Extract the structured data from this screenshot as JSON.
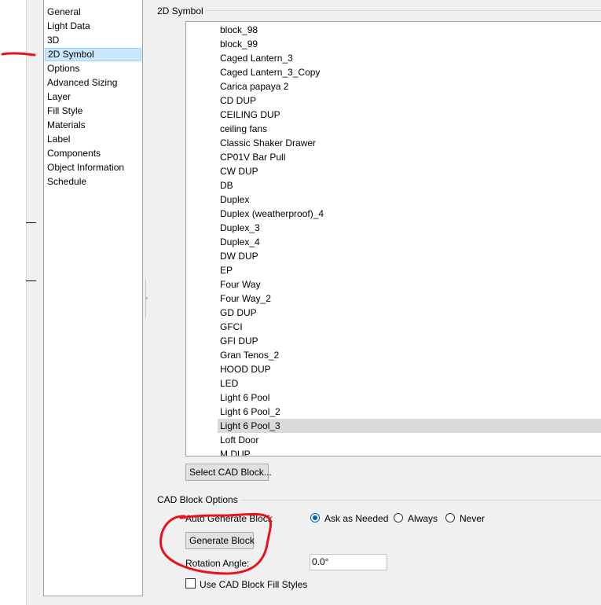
{
  "nav": {
    "items": [
      "General",
      "Light Data",
      "3D",
      "2D Symbol",
      "Options",
      "Advanced Sizing",
      "Layer",
      "Fill Style",
      "Materials",
      "Label",
      "Components",
      "Object Information",
      "Schedule"
    ],
    "selected": "2D Symbol"
  },
  "symbol_group": {
    "title": "2D Symbol",
    "items": [
      "block_98",
      "block_99",
      "Caged Lantern_3",
      "Caged Lantern_3_Copy",
      "Carica papaya 2",
      "CD DUP",
      "CEILING DUP",
      "ceiling fans",
      "Classic Shaker Drawer",
      "CP01V Bar Pull",
      "CW DUP",
      "DB",
      "Duplex",
      "Duplex (weatherproof)_4",
      "Duplex_3",
      "Duplex_4",
      "DW DUP",
      "EP",
      "Four Way",
      "Four Way_2",
      "GD DUP",
      "GFCI",
      "GFI DUP",
      "Gran Tenos_2",
      "HOOD DUP",
      "LED",
      "Light 6 Pool",
      "Light 6 Pool_2",
      "Light 6 Pool_3",
      "Loft Door",
      "M DUP"
    ],
    "selected": "Light 6 Pool_3",
    "select_button": "Select CAD Block..."
  },
  "cad_options": {
    "title": "CAD Block Options",
    "auto_generate_label": "Auto Generate Block",
    "radio_ask": "Ask as Needed",
    "radio_always": "Always",
    "radio_never": "Never",
    "selected_radio": "Ask as Needed",
    "generate_button": "Generate Block",
    "rotation_label": "Rotation Angle:",
    "rotation_value": "0.0°",
    "fill_styles_label": "Use CAD Block Fill Styles",
    "fill_styles_checked": false
  },
  "annotation": {
    "color": "#e8141c"
  }
}
